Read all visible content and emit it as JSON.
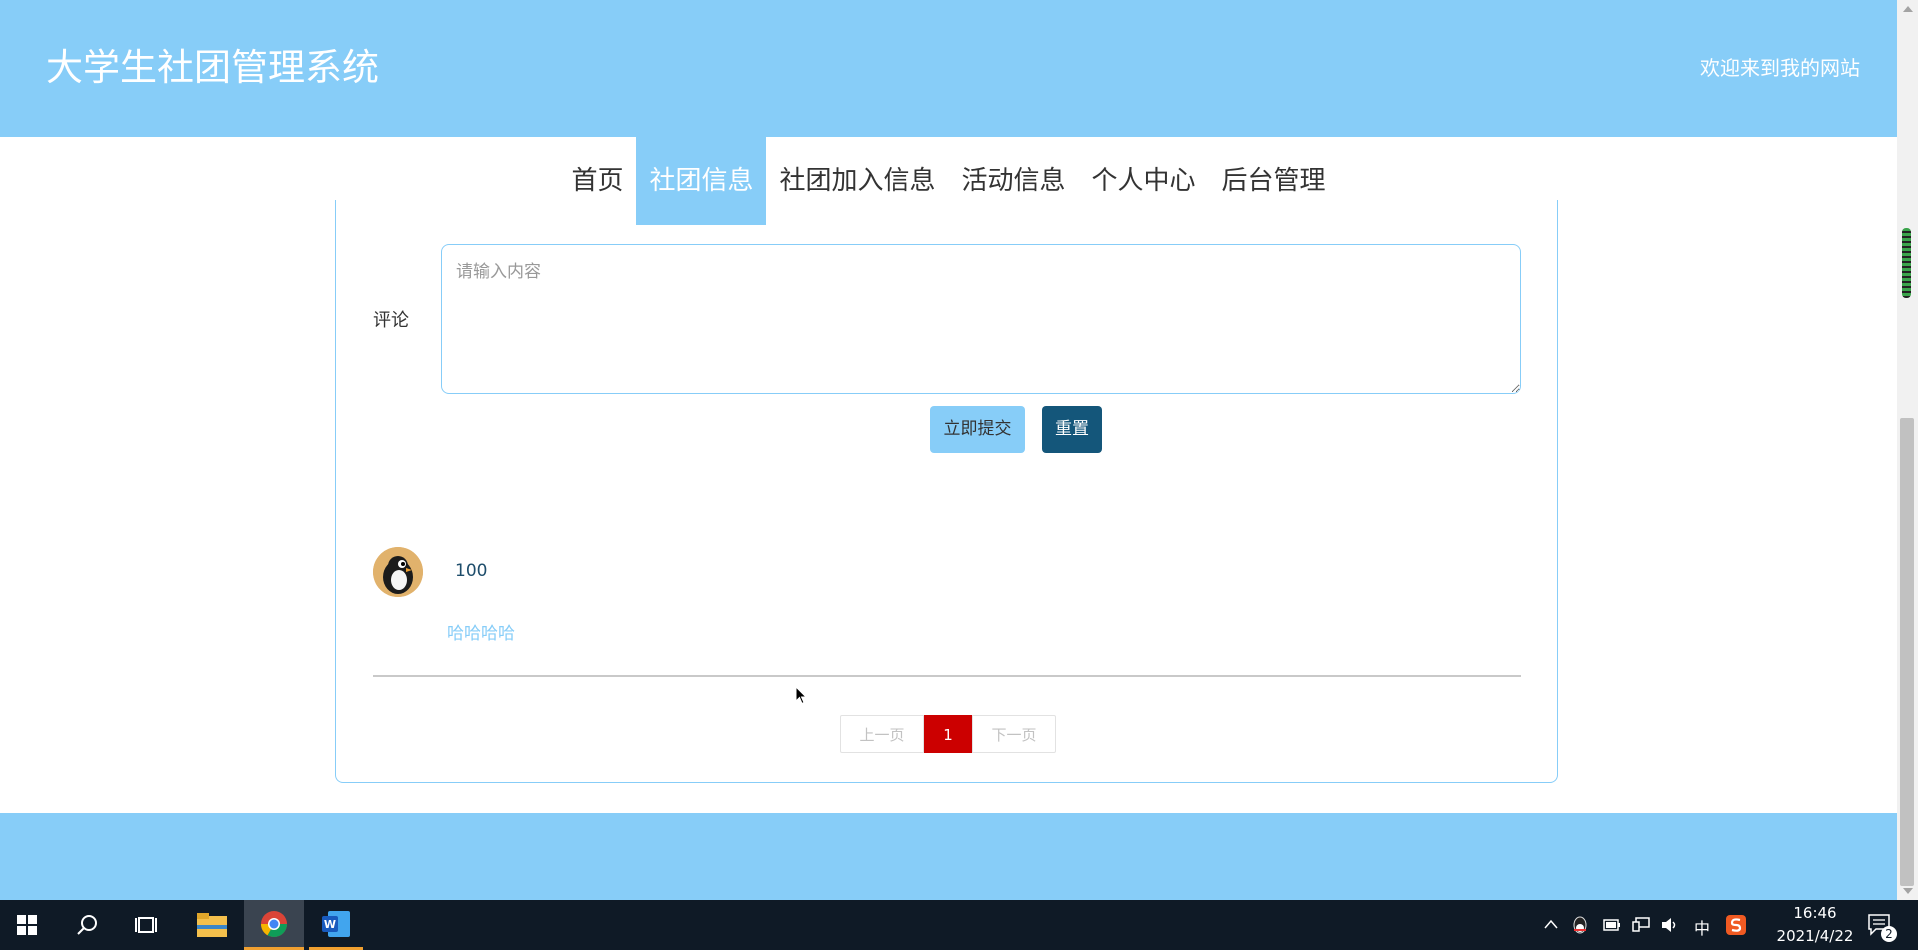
{
  "header": {
    "title": "大学生社团管理系统",
    "welcome": "欢迎来到我的网站"
  },
  "nav": {
    "items": [
      {
        "label": "首页",
        "active": false
      },
      {
        "label": "社团信息",
        "active": true
      },
      {
        "label": "社团加入信息",
        "active": false
      },
      {
        "label": "活动信息",
        "active": false
      },
      {
        "label": "个人中心",
        "active": false
      },
      {
        "label": "后台管理",
        "active": false
      }
    ]
  },
  "comment_form": {
    "label": "评论",
    "placeholder": "请输入内容",
    "value": "",
    "submit_label": "立即提交",
    "reset_label": "重置"
  },
  "comments": [
    {
      "user": "100",
      "text": "哈哈哈哈",
      "avatar": "penguin-avatar"
    }
  ],
  "pagination": {
    "prev": "上一页",
    "current": "1",
    "next": "下一页"
  },
  "colors": {
    "primary": "#87cdf8",
    "dark_button": "#14567a",
    "page_active": "#cc0000"
  },
  "taskbar": {
    "apps": [
      "start-icon",
      "search-icon",
      "task-view-icon",
      "file-explorer-icon",
      "chrome-icon",
      "word-icon"
    ],
    "ime": "中",
    "time": "16:46",
    "date": "2021/4/22",
    "notifications": "2"
  }
}
